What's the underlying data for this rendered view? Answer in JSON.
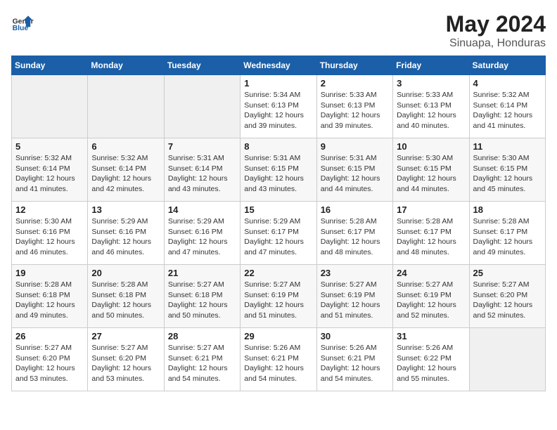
{
  "header": {
    "logo_general": "General",
    "logo_blue": "Blue",
    "title": "May 2024",
    "location": "Sinuapa, Honduras"
  },
  "days_of_week": [
    "Sunday",
    "Monday",
    "Tuesday",
    "Wednesday",
    "Thursday",
    "Friday",
    "Saturday"
  ],
  "weeks": [
    [
      {
        "day": "",
        "info": ""
      },
      {
        "day": "",
        "info": ""
      },
      {
        "day": "",
        "info": ""
      },
      {
        "day": "1",
        "info": "Sunrise: 5:34 AM\nSunset: 6:13 PM\nDaylight: 12 hours\nand 39 minutes."
      },
      {
        "day": "2",
        "info": "Sunrise: 5:33 AM\nSunset: 6:13 PM\nDaylight: 12 hours\nand 39 minutes."
      },
      {
        "day": "3",
        "info": "Sunrise: 5:33 AM\nSunset: 6:13 PM\nDaylight: 12 hours\nand 40 minutes."
      },
      {
        "day": "4",
        "info": "Sunrise: 5:32 AM\nSunset: 6:14 PM\nDaylight: 12 hours\nand 41 minutes."
      }
    ],
    [
      {
        "day": "5",
        "info": "Sunrise: 5:32 AM\nSunset: 6:14 PM\nDaylight: 12 hours\nand 41 minutes."
      },
      {
        "day": "6",
        "info": "Sunrise: 5:32 AM\nSunset: 6:14 PM\nDaylight: 12 hours\nand 42 minutes."
      },
      {
        "day": "7",
        "info": "Sunrise: 5:31 AM\nSunset: 6:14 PM\nDaylight: 12 hours\nand 43 minutes."
      },
      {
        "day": "8",
        "info": "Sunrise: 5:31 AM\nSunset: 6:15 PM\nDaylight: 12 hours\nand 43 minutes."
      },
      {
        "day": "9",
        "info": "Sunrise: 5:31 AM\nSunset: 6:15 PM\nDaylight: 12 hours\nand 44 minutes."
      },
      {
        "day": "10",
        "info": "Sunrise: 5:30 AM\nSunset: 6:15 PM\nDaylight: 12 hours\nand 44 minutes."
      },
      {
        "day": "11",
        "info": "Sunrise: 5:30 AM\nSunset: 6:15 PM\nDaylight: 12 hours\nand 45 minutes."
      }
    ],
    [
      {
        "day": "12",
        "info": "Sunrise: 5:30 AM\nSunset: 6:16 PM\nDaylight: 12 hours\nand 46 minutes."
      },
      {
        "day": "13",
        "info": "Sunrise: 5:29 AM\nSunset: 6:16 PM\nDaylight: 12 hours\nand 46 minutes."
      },
      {
        "day": "14",
        "info": "Sunrise: 5:29 AM\nSunset: 6:16 PM\nDaylight: 12 hours\nand 47 minutes."
      },
      {
        "day": "15",
        "info": "Sunrise: 5:29 AM\nSunset: 6:17 PM\nDaylight: 12 hours\nand 47 minutes."
      },
      {
        "day": "16",
        "info": "Sunrise: 5:28 AM\nSunset: 6:17 PM\nDaylight: 12 hours\nand 48 minutes."
      },
      {
        "day": "17",
        "info": "Sunrise: 5:28 AM\nSunset: 6:17 PM\nDaylight: 12 hours\nand 48 minutes."
      },
      {
        "day": "18",
        "info": "Sunrise: 5:28 AM\nSunset: 6:17 PM\nDaylight: 12 hours\nand 49 minutes."
      }
    ],
    [
      {
        "day": "19",
        "info": "Sunrise: 5:28 AM\nSunset: 6:18 PM\nDaylight: 12 hours\nand 49 minutes."
      },
      {
        "day": "20",
        "info": "Sunrise: 5:28 AM\nSunset: 6:18 PM\nDaylight: 12 hours\nand 50 minutes."
      },
      {
        "day": "21",
        "info": "Sunrise: 5:27 AM\nSunset: 6:18 PM\nDaylight: 12 hours\nand 50 minutes."
      },
      {
        "day": "22",
        "info": "Sunrise: 5:27 AM\nSunset: 6:19 PM\nDaylight: 12 hours\nand 51 minutes."
      },
      {
        "day": "23",
        "info": "Sunrise: 5:27 AM\nSunset: 6:19 PM\nDaylight: 12 hours\nand 51 minutes."
      },
      {
        "day": "24",
        "info": "Sunrise: 5:27 AM\nSunset: 6:19 PM\nDaylight: 12 hours\nand 52 minutes."
      },
      {
        "day": "25",
        "info": "Sunrise: 5:27 AM\nSunset: 6:20 PM\nDaylight: 12 hours\nand 52 minutes."
      }
    ],
    [
      {
        "day": "26",
        "info": "Sunrise: 5:27 AM\nSunset: 6:20 PM\nDaylight: 12 hours\nand 53 minutes."
      },
      {
        "day": "27",
        "info": "Sunrise: 5:27 AM\nSunset: 6:20 PM\nDaylight: 12 hours\nand 53 minutes."
      },
      {
        "day": "28",
        "info": "Sunrise: 5:27 AM\nSunset: 6:21 PM\nDaylight: 12 hours\nand 54 minutes."
      },
      {
        "day": "29",
        "info": "Sunrise: 5:26 AM\nSunset: 6:21 PM\nDaylight: 12 hours\nand 54 minutes."
      },
      {
        "day": "30",
        "info": "Sunrise: 5:26 AM\nSunset: 6:21 PM\nDaylight: 12 hours\nand 54 minutes."
      },
      {
        "day": "31",
        "info": "Sunrise: 5:26 AM\nSunset: 6:22 PM\nDaylight: 12 hours\nand 55 minutes."
      },
      {
        "day": "",
        "info": ""
      }
    ]
  ]
}
